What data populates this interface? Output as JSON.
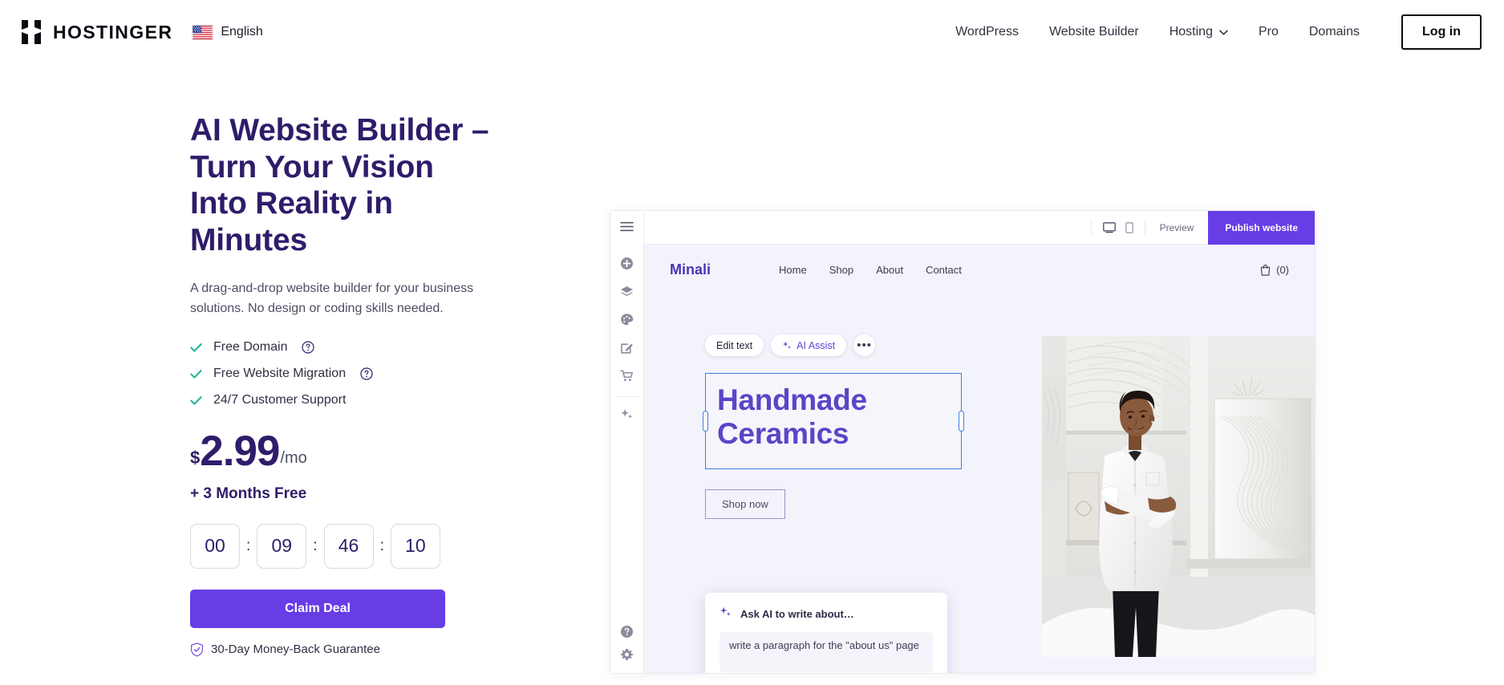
{
  "header": {
    "logo_icon": "hostinger-h-logo",
    "logo_text": "HOSTINGER",
    "flag_icon": "us-flag-icon",
    "language": "English",
    "nav": [
      {
        "label": "WordPress",
        "has_chevron": false
      },
      {
        "label": "Website Builder",
        "has_chevron": false
      },
      {
        "label": "Hosting",
        "has_chevron": true
      },
      {
        "label": "Pro",
        "has_chevron": false
      },
      {
        "label": "Domains",
        "has_chevron": false
      }
    ],
    "login_label": "Log in"
  },
  "hero": {
    "title": "AI Website Builder – Turn Your Vision Into Reality in Minutes",
    "subtitle": "A drag-and-drop website builder for your business solutions. No design or coding skills needed.",
    "features": [
      {
        "label": "Free Domain",
        "has_help": true
      },
      {
        "label": "Free Website Migration",
        "has_help": true
      },
      {
        "label": "24/7 Customer Support",
        "has_help": false
      }
    ],
    "price": {
      "currency": "$",
      "amount": "2.99",
      "period": "/mo"
    },
    "bonus": "+ 3 Months Free",
    "timer": {
      "units": [
        "00",
        "09",
        "46",
        "10"
      ],
      "separator": ":"
    },
    "cta_label": "Claim Deal",
    "guarantee": "30-Day Money-Back Guarantee",
    "guarantee_icon": "shield-check-icon"
  },
  "builder": {
    "menu_icon": "hamburger-menu-icon",
    "sidebar_icons": [
      "add-element-icon",
      "layers-icon",
      "palette-icon",
      "edit-pencil-icon",
      "shopping-cart-icon",
      "ai-sparkle-icon"
    ],
    "sidebar_bottom_icons": [
      "help-circle-icon",
      "settings-gear-icon"
    ],
    "topbar": {
      "desktop_icon": "desktop-view-icon",
      "mobile_icon": "mobile-view-icon",
      "preview_label": "Preview",
      "publish_label": "Publish website"
    },
    "site": {
      "logo": "Minali",
      "nav": [
        "Home",
        "Shop",
        "About",
        "Contact"
      ],
      "cart_icon": "shopping-bag-icon",
      "cart_count": "(0)"
    },
    "edit_toolbar": {
      "edit_text_label": "Edit text",
      "ai_assist_label": "AI Assist",
      "ai_assist_icon": "sparkle-icon",
      "more_label": "•••"
    },
    "headline": "Handmade Ceramics",
    "shop_now_label": "Shop now",
    "photo_alt": "woman-in-ceramics-studio-photo",
    "ai_panel": {
      "icon": "sparkle-icon",
      "title": "Ask AI to write about…",
      "input_value": "write a paragraph for the \"about us\" page"
    }
  },
  "colors": {
    "brand_purple": "#673de6",
    "heading_purple": "#2f1c6a",
    "accent_green": "#2bb79a",
    "canvas_bg": "#f3f3fb",
    "selection_blue": "#3b7ddd"
  }
}
